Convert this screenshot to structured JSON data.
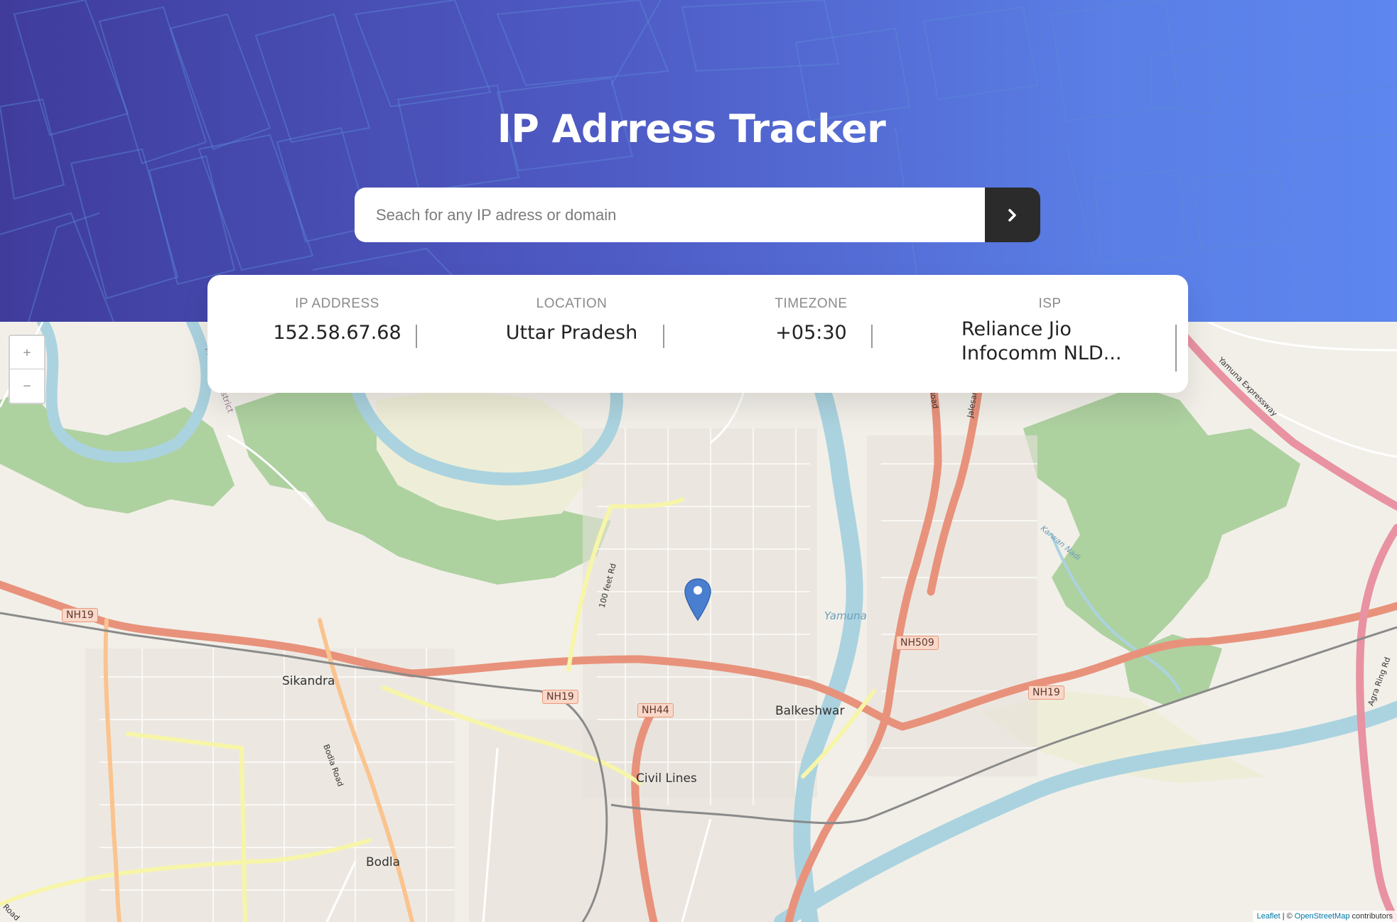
{
  "header": {
    "title": "IP Adrress Tracker",
    "search_placeholder": "Seach for any IP adress or domain",
    "search_button_icon": "chevron-right-icon"
  },
  "stats": [
    {
      "label": "IP ADDRESS",
      "value": "152.58.67.68"
    },
    {
      "label": "LOCATION",
      "value": "Uttar Pradesh"
    },
    {
      "label": "TIMEZONE",
      "value": "+05:30"
    },
    {
      "label": "ISP",
      "value": "Reliance Jio Infocomm NLD..."
    }
  ],
  "map": {
    "zoom_in": "+",
    "zoom_out": "−",
    "marker_icon": "location-pin-icon",
    "attribution": {
      "leaflet": "Leaflet",
      "osm": "OpenStreetMap",
      "copy": "©",
      "suffix": "contributors"
    },
    "places": [
      "Sikandra",
      "Balkeshwar",
      "Civil Lines",
      "Bodla",
      "Yamuna",
      "Mathura District",
      "100 feet Rd",
      "Bodla Road",
      "Hathras Road",
      "Jalesar Road",
      "Yamuna Expressway",
      "Karwan Nadi",
      "Agra Ring Rd",
      "Road"
    ],
    "highway_shields": [
      "NH19",
      "NH19",
      "NH44",
      "NH509",
      "NH19"
    ]
  },
  "colors": {
    "accent_dark": "#2b2b2b",
    "header_start": "#3f3c9c",
    "header_end": "#5d86ee",
    "marker": "#4a7fcf"
  }
}
